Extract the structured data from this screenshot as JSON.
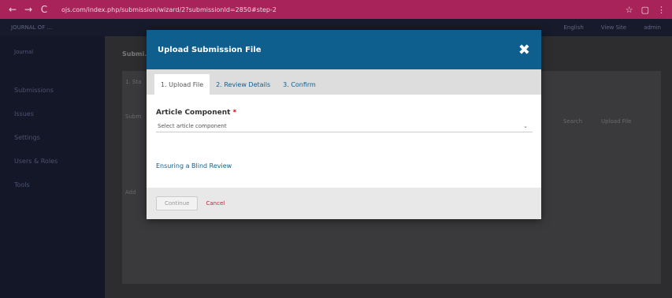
{
  "browser": {
    "back": "←",
    "forward": "→",
    "reload": "C",
    "url": "ojs.com/index.php/submission/wizard/2?submissionId=2850#step-2",
    "right_icons": [
      "☆",
      "▢",
      "⋮"
    ]
  },
  "app_header": {
    "site": "JOURNAL OF ...",
    "right": [
      "English",
      "View Site",
      "admin"
    ]
  },
  "sidebar": {
    "logo": "Journal",
    "items": [
      {
        "label": "Submissions"
      },
      {
        "label": "Issues"
      },
      {
        "label": "Settings"
      },
      {
        "label": "Users & Roles"
      },
      {
        "label": "Tools"
      }
    ]
  },
  "main": {
    "title": "Submi...",
    "hints": [
      "1. Sta",
      "Subm",
      "Search",
      "Upload File",
      "Add"
    ]
  },
  "modal": {
    "title": "Upload Submission File",
    "close": "✖",
    "tabs": [
      "1. Upload File",
      "2. Review Details",
      "3. Confirm"
    ],
    "field_label": "Article Component",
    "required_mark": "*",
    "select_placeholder": "Select article component",
    "blind_review_link": "Ensuring a Blind Review",
    "continue_label": "Continue",
    "cancel_label": "Cancel"
  },
  "colors": {
    "browser_bar": "#a8235a",
    "modal_header": "#0e5e8e",
    "link": "#0e5e8e",
    "cancel": "#c0223b"
  }
}
